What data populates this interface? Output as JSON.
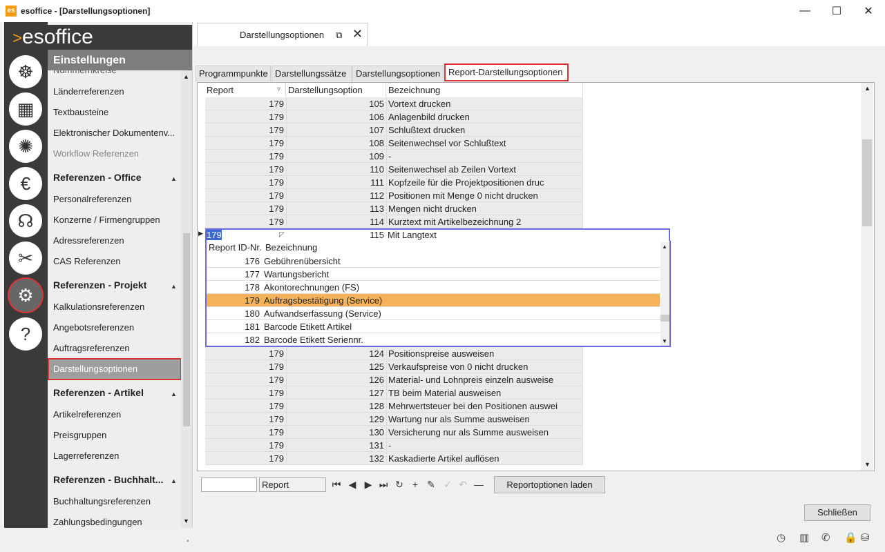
{
  "window": {
    "app_icon": "es",
    "title": "esoffice - [Darstellungsoptionen]",
    "minimize": "—",
    "maximize": "☐",
    "close": "✕"
  },
  "logo": {
    "arrow": ">",
    "text": "esoffice"
  },
  "nav_icons": [
    {
      "name": "ship-wheel-icon",
      "glyph": "☸"
    },
    {
      "name": "calculator-icon",
      "glyph": "▦"
    },
    {
      "name": "alarm-light-icon",
      "glyph": "✺"
    },
    {
      "name": "euro-icon",
      "glyph": "€"
    },
    {
      "name": "headset-icon",
      "glyph": "☊"
    },
    {
      "name": "tools-icon",
      "glyph": "✂"
    },
    {
      "name": "gears-icon",
      "glyph": "⚙"
    },
    {
      "name": "help-icon",
      "glyph": "?"
    }
  ],
  "sidemenu": {
    "header": "Einstellungen",
    "cut_item": "Nummernkreise",
    "items_top": [
      "Länderreferenzen",
      "Textbausteine",
      "Elektronischer Dokumentenv...",
      "Workflow Referenzen"
    ],
    "sections": [
      {
        "title": "Referenzen - Office",
        "caret": "▲",
        "items": [
          "Personalreferenzen",
          "Konzerne / Firmengruppen",
          "Adressreferenzen",
          "CAS Referenzen"
        ]
      },
      {
        "title": "Referenzen - Projekt",
        "caret": "▲",
        "items": [
          "Kalkulationsreferenzen",
          "Angebotsreferenzen",
          "Auftragsreferenzen",
          "Darstellungsoptionen"
        ]
      },
      {
        "title": "Referenzen - Artikel",
        "caret": "▲",
        "items": [
          "Artikelreferenzen",
          "Preisgruppen",
          "Lagerreferenzen"
        ]
      },
      {
        "title": "Referenzen - Buchhalt...",
        "caret": "▲",
        "items": [
          "Buchhaltungsreferenzen",
          "Zahlungsbedingungen"
        ]
      }
    ],
    "scroll_up": "▲",
    "scroll_down": "▼"
  },
  "doc_tab": {
    "label": "Darstellungsoptionen",
    "popout": "⧉",
    "close": "✕"
  },
  "tabs": [
    "Programmpunkte",
    "Darstellungssätze",
    "Darstellungsoptionen",
    "Report-Darstellungsoptionen"
  ],
  "grid": {
    "columns": [
      "Report",
      "Darstellungsoption",
      "Bezeichnung"
    ],
    "sort_glyph": "▿",
    "rows_top": [
      [
        "179",
        "105",
        "Vortext drucken"
      ],
      [
        "179",
        "106",
        "Anlagenbild drucken"
      ],
      [
        "179",
        "107",
        "Schlußtext drucken"
      ],
      [
        "179",
        "108",
        "Seitenwechsel vor Schlußtext"
      ],
      [
        "179",
        "109",
        "-"
      ],
      [
        "179",
        "110",
        "Seitenwechsel ab Zeilen Vortext"
      ],
      [
        "179",
        "111",
        "Kopfzeile für die Projektpositionen druc"
      ],
      [
        "179",
        "112",
        "Positionen mit Menge 0 nicht drucken"
      ],
      [
        "179",
        "113",
        "Mengen nicht drucken"
      ],
      [
        "179",
        "114",
        "Kurztext mit Artikelbezeichnung 2"
      ]
    ],
    "current_row": [
      "179",
      "115",
      "Mit Langtext"
    ],
    "row_indicator": "▶",
    "rows_bottom": [
      [
        "179",
        "124",
        "Positionspreise ausweisen"
      ],
      [
        "179",
        "125",
        "Verkaufspreise von 0 nicht drucken"
      ],
      [
        "179",
        "126",
        "Material- und Lohnpreis einzeln ausweise"
      ],
      [
        "179",
        "127",
        "TB beim Material ausweisen"
      ],
      [
        "179",
        "128",
        "Mehrwertsteuer bei den Positionen auswei"
      ],
      [
        "179",
        "129",
        "Wartung nur als Summe ausweisen"
      ],
      [
        "179",
        "130",
        "Versicherung nur als Summe ausweisen"
      ],
      [
        "179",
        "131",
        "-"
      ],
      [
        "179",
        "132",
        "Kaskadierte Artikel auflösen"
      ]
    ],
    "scroll_up": "▲",
    "scroll_down": "▼"
  },
  "dropdown": {
    "edit_value": "179",
    "columns": [
      "Report ID-Nr.",
      "Bezeichnung"
    ],
    "rows": [
      [
        "176",
        "Gebührenübersicht"
      ],
      [
        "177",
        "Wartungsbericht"
      ],
      [
        "178",
        "Akontorechnungen (FS)"
      ],
      [
        "179",
        "Auftragsbestätigung (Service)"
      ],
      [
        "180",
        "Aufwandserfassung (Service)"
      ],
      [
        "181",
        "Barcode Etikett Artikel"
      ],
      [
        "182",
        "Barcode Etikett Seriennr."
      ]
    ],
    "selected_id": "179",
    "scroll_up": "▲",
    "scroll_down": "▼",
    "arrow": "◸"
  },
  "navigator": {
    "search_value": "",
    "field_value": "Report",
    "buttons": [
      "⏮",
      "◀",
      "▶",
      "⏭",
      "↻",
      "+",
      "✎",
      "✓",
      "↶",
      "—"
    ],
    "button_names": [
      "first-record-icon",
      "prev-record-icon",
      "next-record-icon",
      "last-record-icon",
      "refresh-icon",
      "add-icon",
      "edit-icon",
      "confirm-icon",
      "undo-icon",
      "delete-icon"
    ],
    "load_button": "Reportoptionen laden"
  },
  "close_button": "Schließen",
  "statusbar": {
    "grip": "▪",
    "icons": [
      {
        "name": "clock-icon",
        "glyph": "◷"
      },
      {
        "name": "building-icon",
        "glyph": "▥"
      },
      {
        "name": "phone-icon",
        "glyph": "✆"
      },
      {
        "name": "lock-icon",
        "glyph": "🔒"
      },
      {
        "name": "database-icon",
        "glyph": "⛁"
      }
    ]
  }
}
